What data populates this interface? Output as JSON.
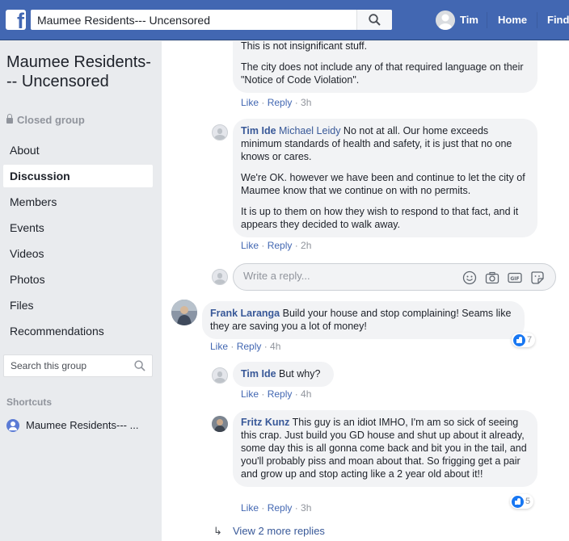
{
  "topbar": {
    "logo": "f",
    "search_value": "Maumee Residents--- Uncensored",
    "user_name": "Tim",
    "links": [
      "Home",
      "Find"
    ]
  },
  "sidebar": {
    "group_title": "Maumee Residents--- Uncensored",
    "privacy": "Closed group",
    "items": [
      {
        "label": "About",
        "active": false
      },
      {
        "label": "Discussion",
        "active": true
      },
      {
        "label": "Members",
        "active": false
      },
      {
        "label": "Events",
        "active": false
      },
      {
        "label": "Videos",
        "active": false
      },
      {
        "label": "Photos",
        "active": false
      },
      {
        "label": "Files",
        "active": false
      },
      {
        "label": "Recommendations",
        "active": false
      }
    ],
    "search_placeholder": "Search this group",
    "shortcuts_title": "Shortcuts",
    "shortcut_label": "Maumee Residents--- ..."
  },
  "comments": {
    "c1": {
      "p1": "This is not insignificant stuff.",
      "p2": "The city does not include any of that required language on their \"Notice of Code Violation\".",
      "like": "Like",
      "reply": "Reply",
      "time": "3h"
    },
    "c2": {
      "author": "Tim Ide",
      "mention": "Michael Leidy",
      "p1_text": " No not at all. Our home exceeds minimum standards of health and safety, it is just that no one knows or cares.",
      "p2": "We're OK. however we have been and continue to let the city of Maumee know that we continue on with no permits.",
      "p3": "It is up to them on how they wish to respond to that fact, and it appears they decided to walk away.",
      "like": "Like",
      "reply": "Reply",
      "time": "2h"
    },
    "reply_box": {
      "placeholder": "Write a reply..."
    },
    "c3": {
      "author": "Frank Laranga",
      "text": " Build your house and stop complaining! Seams like they are saving you a lot of money!",
      "like": "Like",
      "reply": "Reply",
      "time": "4h",
      "reactions": "7"
    },
    "c4": {
      "author": "Tim Ide",
      "text": " But why?",
      "like": "Like",
      "reply": "Reply",
      "time": "4h"
    },
    "c5": {
      "author": "Fritz Kunz",
      "text": " This guy is an idiot IMHO, I'm am so sick of seeing this crap. Just build you GD house and shut up about it already, some day this is all gonna come back and bit you in the tail, and you'll probably piss and moan about that. So frigging get a pair and grow up and stop acting like a 2 year old about it!!",
      "like": "Like",
      "reply": "Reply",
      "time": "3h",
      "reactions": "5"
    },
    "view_more": "View 2 more replies"
  },
  "colors": {
    "topbar": "#4267b2",
    "link": "#385898",
    "bubble": "#f2f3f5",
    "like_blue": "#1877f2"
  },
  "icons": [
    "facebook-logo-icon",
    "search-icon",
    "lock-icon",
    "group-icon",
    "emoji-icon",
    "camera-icon",
    "gif-icon",
    "sticker-icon",
    "like-reaction-icon",
    "reply-arrow-icon"
  ]
}
